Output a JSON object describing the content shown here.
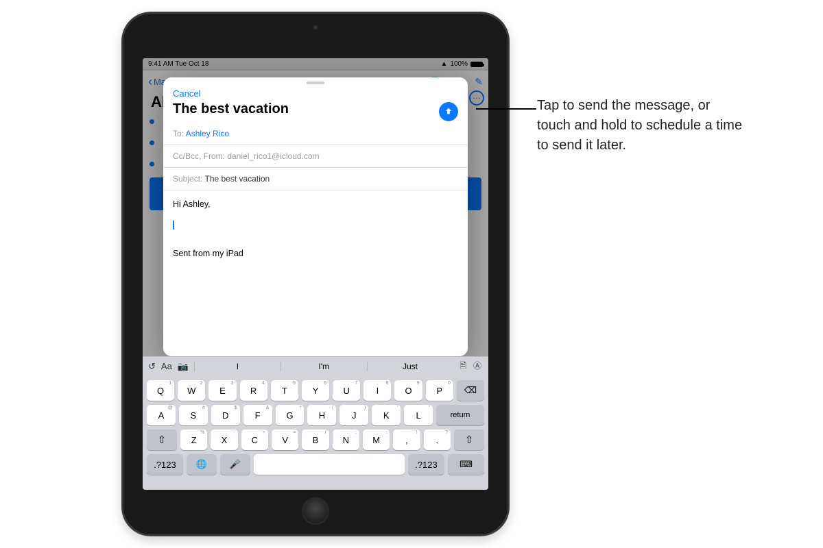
{
  "status": {
    "time": "9:41 AM  Tue Oct 18",
    "wifi_icon": "wifi",
    "battery_pct": "100%"
  },
  "bg": {
    "back_label": "Mailboxes",
    "edit_label": "Edit",
    "title": "All Inboxes"
  },
  "compose": {
    "cancel": "Cancel",
    "title": "The best vacation",
    "to_label": "To:",
    "to_value": "Ashley Rico",
    "ccbcc": "Cc/Bcc, From: daniel_rico1@icloud.com",
    "subject_label": "Subject:",
    "subject_value": "The best vacation",
    "greeting": "Hi Ashley,",
    "signature": "Sent from my iPad"
  },
  "keyboard": {
    "suggestions": [
      "I",
      "I'm",
      "Just"
    ],
    "row1": [
      {
        "k": "Q",
        "a": "1"
      },
      {
        "k": "W",
        "a": "2"
      },
      {
        "k": "E",
        "a": "3"
      },
      {
        "k": "R",
        "a": "4"
      },
      {
        "k": "T",
        "a": "5"
      },
      {
        "k": "Y",
        "a": "6"
      },
      {
        "k": "U",
        "a": "7"
      },
      {
        "k": "I",
        "a": "8"
      },
      {
        "k": "O",
        "a": "9"
      },
      {
        "k": "P",
        "a": "0"
      }
    ],
    "row2": [
      {
        "k": "A",
        "a": "@"
      },
      {
        "k": "S",
        "a": "#"
      },
      {
        "k": "D",
        "a": "$"
      },
      {
        "k": "F",
        "a": "&"
      },
      {
        "k": "G",
        "a": "*"
      },
      {
        "k": "H",
        "a": "("
      },
      {
        "k": "J",
        "a": ")"
      },
      {
        "k": "K",
        "a": "'"
      },
      {
        "k": "L",
        "a": "\""
      }
    ],
    "row3": [
      {
        "k": "Z",
        "a": "%"
      },
      {
        "k": "X",
        "a": "-"
      },
      {
        "k": "C",
        "a": "+"
      },
      {
        "k": "V",
        "a": "="
      },
      {
        "k": "B",
        "a": "/"
      },
      {
        "k": "N",
        "a": ";"
      },
      {
        "k": "M",
        "a": ":"
      },
      {
        "k": ",",
        "a": "!"
      },
      {
        "k": ".",
        "a": "?"
      }
    ],
    "mode_key": ".?123",
    "return_key": "return"
  },
  "annotation": "Tap to send the message, or touch and hold to schedule a time to send it later."
}
